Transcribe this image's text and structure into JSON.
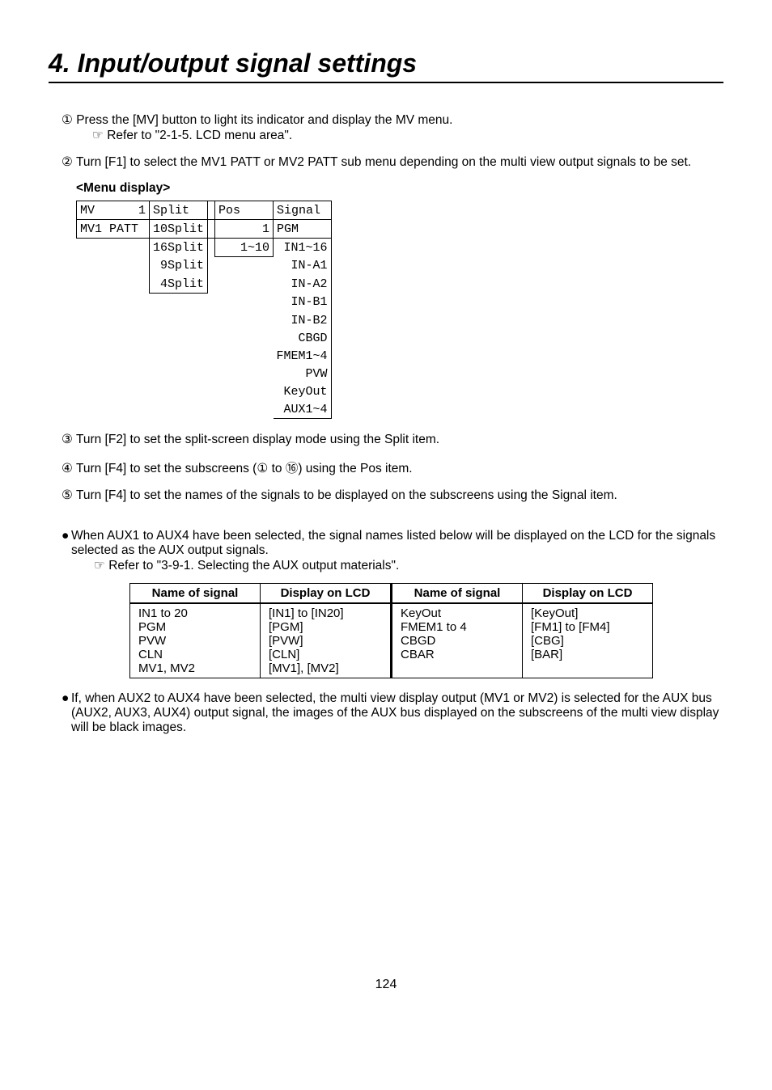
{
  "title": "4. Input/output signal settings",
  "steps": {
    "s1": {
      "num": "1",
      "text": "Press the [MV] button to light its indicator and display the MV menu.",
      "refer": "Refer to \"2-1-5. LCD menu area\"."
    },
    "s2": {
      "num": "2",
      "text": "Turn [F1] to select the MV1 PATT or MV2 PATT sub menu depending on the multi view output signals to be set."
    },
    "s3": {
      "num": "3",
      "text": "Turn [F2] to set the split-screen display mode using the Split item."
    },
    "s4": {
      "num": "4",
      "text_a": "Turn [F4] to set the subscreens (",
      "text_b": " to ",
      "text_c": ") using the Pos item.",
      "inner1": "1",
      "inner16": "16"
    },
    "s5": {
      "num": "5",
      "text": "Turn [F4] to set the names of the signals to be displayed on the subscreens using the Signal item."
    }
  },
  "menu_label": "<Menu display>",
  "menu": {
    "h1": "MV      1",
    "h2": "Split  ",
    "h3": "",
    "h4": "Pos    ",
    "h5": "Signal",
    "r1a": "MV1 PATT",
    "r1b": "10Split",
    "r1c": "      1",
    "r1d": "PGM",
    "opt_split": [
      "16Split",
      "9Split",
      "4Split"
    ],
    "opt_pos": "1~10",
    "opt_signal": [
      "IN1~16",
      "IN-A1",
      "IN-A2",
      "IN-B1",
      "IN-B2",
      "CBGD",
      "FMEM1~4",
      "PVW",
      "KeyOut",
      "AUX1~4"
    ]
  },
  "bullets": {
    "bA": "When AUX1 to AUX4 have been selected, the signal names listed below will be displayed on the LCD for the signals selected as the AUX output signals.",
    "bA_refer": "Refer to \"3-9-1. Selecting the AUX output materials\".",
    "bB": "If, when AUX2 to AUX4 have been selected, the multi view display output (MV1 or MV2) is selected for the AUX bus (AUX2, AUX3, AUX4) output signal, the images of the AUX bus displayed on the subscreens of the multi view display will be black images."
  },
  "table": {
    "headers": [
      "Name of signal",
      "Display on LCD",
      "Name of signal",
      "Display on LCD"
    ],
    "rows": [
      [
        "IN1 to 20",
        "[IN1] to [IN20]",
        "KeyOut",
        "[KeyOut]"
      ],
      [
        "PGM",
        "[PGM]",
        "FMEM1 to 4",
        "[FM1] to [FM4]"
      ],
      [
        "PVW",
        "[PVW]",
        "CBGD",
        "[CBG]"
      ],
      [
        "CLN",
        "[CLN]",
        "CBAR",
        "[BAR]"
      ],
      [
        "MV1, MV2",
        "[MV1], [MV2]",
        "",
        ""
      ]
    ]
  },
  "page_number": "124"
}
